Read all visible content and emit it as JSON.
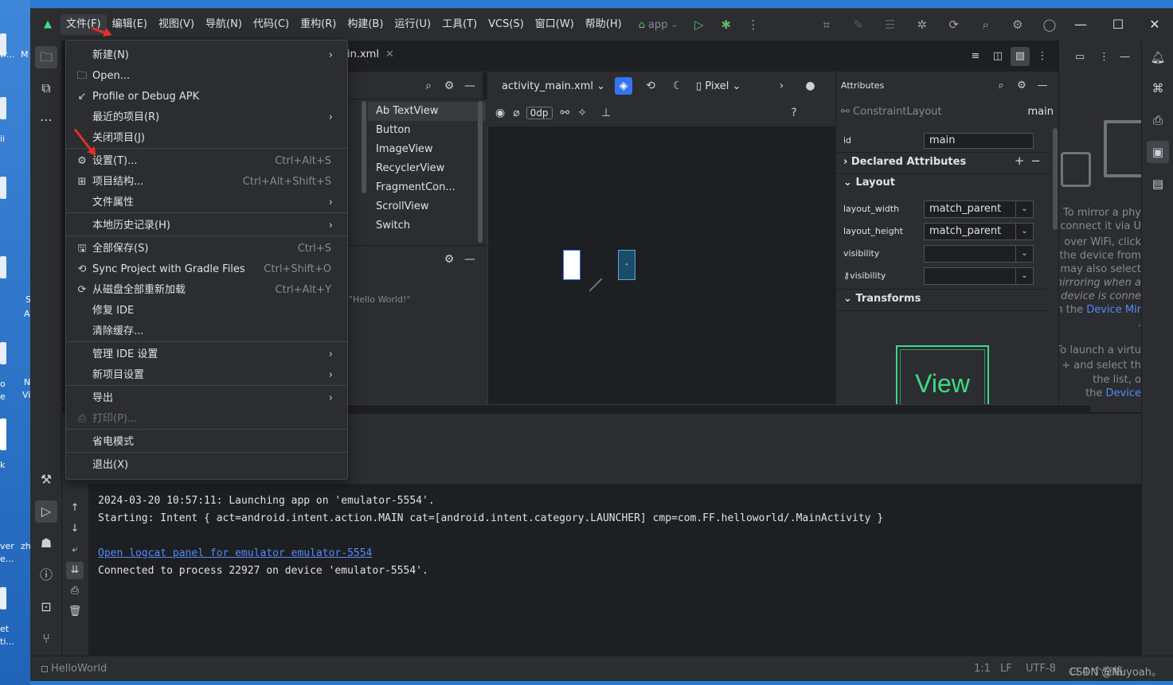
{
  "desktop": {
    "labels": [
      "tr...",
      "M",
      "ii",
      "S",
      "A",
      "o",
      "e",
      "N",
      "Vi",
      "k",
      "ver",
      "zh",
      "e...",
      "et",
      "ti..."
    ]
  },
  "menubar": {
    "items": [
      "文件(F)",
      "编辑(E)",
      "视图(V)",
      "导航(N)",
      "代码(C)",
      "重构(R)",
      "构建(B)",
      "运行(U)",
      "工具(T)",
      "VCS(S)",
      "窗口(W)",
      "帮助(H)"
    ],
    "run_config": "app"
  },
  "file_menu": {
    "items": [
      {
        "icon": "",
        "label": "新建(N)",
        "shortcut": "",
        "submenu": true
      },
      {
        "icon": "folder-icon",
        "label": "Open...",
        "shortcut": "",
        "submenu": false
      },
      {
        "icon": "profile-apk-icon",
        "label": "Profile or Debug APK",
        "shortcut": "",
        "submenu": false
      },
      {
        "icon": "",
        "label": "最近的项目(R)",
        "shortcut": "",
        "submenu": true
      },
      {
        "icon": "",
        "label": "关闭项目(J)",
        "shortcut": "",
        "submenu": false
      },
      {
        "icon": "gear-icon",
        "label": "设置(T)...",
        "shortcut": "Ctrl+Alt+S",
        "submenu": false
      },
      {
        "icon": "project-structure-icon",
        "label": "项目结构...",
        "shortcut": "Ctrl+Alt+Shift+S",
        "submenu": false
      },
      {
        "icon": "",
        "label": "文件属性",
        "shortcut": "",
        "submenu": true
      },
      {
        "icon": "",
        "label": "本地历史记录(H)",
        "shortcut": "",
        "submenu": true
      },
      {
        "icon": "save-icon",
        "label": "全部保存(S)",
        "shortcut": "Ctrl+S",
        "submenu": false
      },
      {
        "icon": "gradle-sync-icon",
        "label": "Sync Project with Gradle Files",
        "shortcut": "Ctrl+Shift+O",
        "submenu": false
      },
      {
        "icon": "reload-icon",
        "label": "从磁盘全部重新加载",
        "shortcut": "Ctrl+Alt+Y",
        "submenu": false
      },
      {
        "icon": "",
        "label": "修复 IDE",
        "shortcut": "",
        "submenu": false
      },
      {
        "icon": "",
        "label": "清除缓存...",
        "shortcut": "",
        "submenu": false
      },
      {
        "icon": "",
        "label": "管理 IDE 设置",
        "shortcut": "",
        "submenu": true
      },
      {
        "icon": "",
        "label": "新项目设置",
        "shortcut": "",
        "submenu": true
      },
      {
        "icon": "",
        "label": "导出",
        "shortcut": "",
        "submenu": true
      },
      {
        "icon": "print-icon",
        "label": "打印(P)...",
        "shortcut": "",
        "submenu": false,
        "disabled": true
      },
      {
        "icon": "",
        "label": "省电模式",
        "shortcut": "",
        "submenu": false
      },
      {
        "icon": "",
        "label": "退出(X)",
        "shortcut": "",
        "submenu": false
      }
    ]
  },
  "editor": {
    "tab_label": "in.xml",
    "file_dropdown": "activity_main.xml",
    "device": "Pixel",
    "dp_value": "0dp"
  },
  "palette": {
    "items": [
      "Ab TextView",
      "Button",
      "ImageView",
      "RecyclerView",
      "FragmentCon...",
      "ScrollView",
      "Switch"
    ]
  },
  "component_tree": {
    "preview_text": "\"Hello World!\""
  },
  "attributes": {
    "title": "Attributes",
    "layout_class": "ConstraintLayout",
    "layout_id": "main",
    "id_label": "id",
    "id_value": "main",
    "sections": {
      "declared": "Declared Attributes",
      "layout": "Layout",
      "transforms": "Transforms"
    },
    "rows": [
      {
        "label": "layout_width",
        "value": "match_parent"
      },
      {
        "label": "layout_height",
        "value": "match_parent"
      },
      {
        "label": "visibility",
        "value": ""
      },
      {
        "label": "visibility",
        "value": ""
      }
    ],
    "preview_label": "View"
  },
  "mirroring": {
    "lines": [
      {
        "text": "To mirror a phy",
        "italic": false
      },
      {
        "text": "connect it via U",
        "italic": false
      },
      {
        "text": "over WiFi, click",
        "italic": false
      },
      {
        "text": "the device from",
        "italic": false
      },
      {
        "text": "may also select",
        "italic": false
      },
      {
        "text": "mirroring when a",
        "italic": true
      },
      {
        "text": "device is conne",
        "italic": true
      },
      {
        "text": "in the ",
        "italic": false,
        "link": "Device Mir"
      },
      {
        "text": ".",
        "italic": false
      }
    ],
    "lines2": [
      {
        "text": "To launch a virtu",
        "link": ""
      },
      {
        "text": "+ and select th",
        "link": ""
      },
      {
        "text": "the list, o",
        "link": ""
      },
      {
        "text": "the ",
        "link": "Device"
      }
    ]
  },
  "console": {
    "lines": [
      {
        "text": "2024-03-20 10:57:11: Launching app on 'emulator-5554'.",
        "link": false
      },
      {
        "text": "Starting: Intent { act=android.intent.action.MAIN cat=[android.intent.category.LAUNCHER] cmp=com.FF.helloworld/.MainActivity }",
        "link": false
      },
      {
        "text": "",
        "link": false
      },
      {
        "text": "Open logcat panel for emulator emulator-5554",
        "link": true
      },
      {
        "text": "Connected to process 22927 on device 'emulator-5554'.",
        "link": false
      }
    ]
  },
  "statusbar": {
    "project": "HelloWorld",
    "position": "1:1",
    "line_sep": "LF",
    "encoding": "UTF-8",
    "indent": "4 个空格"
  },
  "watermark": "CSDN @Nuyoah。"
}
